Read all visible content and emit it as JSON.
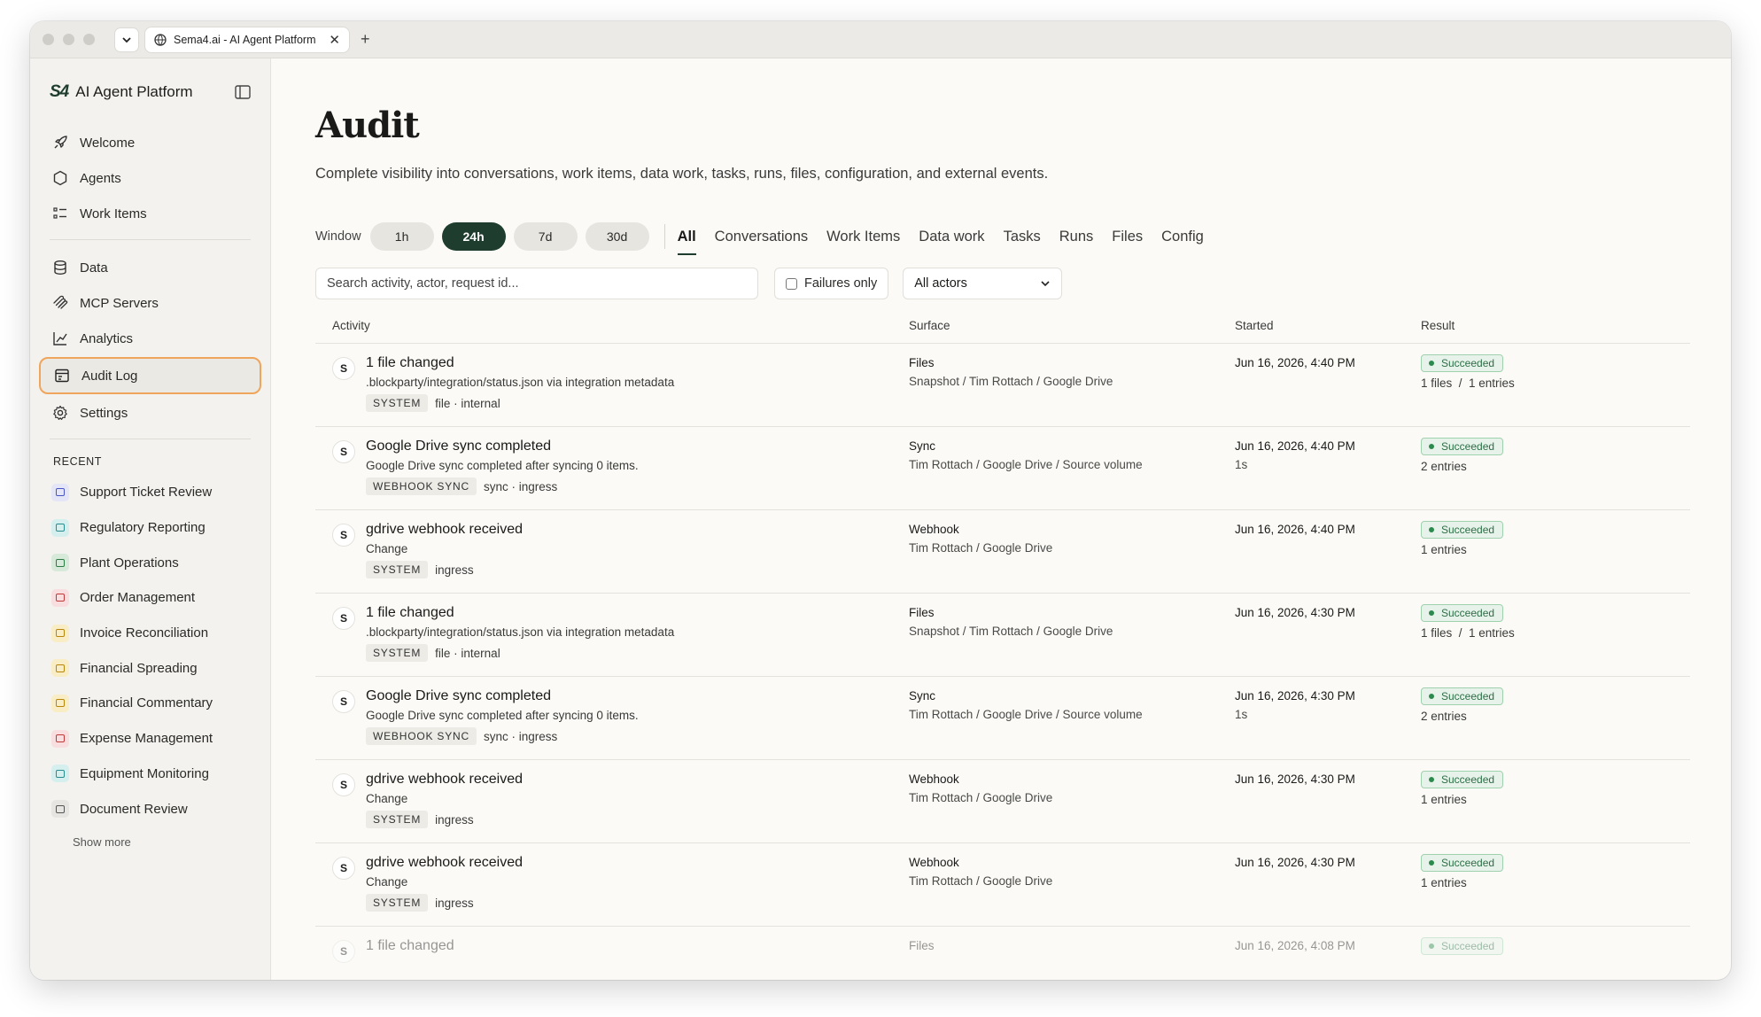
{
  "browser": {
    "tab_title": "Sema4.ai - AI Agent Platform",
    "tab_close": "✕",
    "new_tab": "+"
  },
  "sidebar": {
    "logo": "S4",
    "app_name": "AI Agent Platform",
    "primary": [
      {
        "label": "Welcome",
        "icon": "rocket-icon"
      },
      {
        "label": "Agents",
        "icon": "hexagon-icon"
      },
      {
        "label": "Work Items",
        "icon": "list-icon"
      }
    ],
    "secondary": [
      {
        "label": "Data",
        "icon": "database-icon"
      },
      {
        "label": "MCP Servers",
        "icon": "mcp-icon"
      },
      {
        "label": "Analytics",
        "icon": "chart-icon"
      },
      {
        "label": "Audit Log",
        "icon": "audit-icon",
        "active": true
      },
      {
        "label": "Settings",
        "icon": "gear-icon"
      }
    ],
    "recent_title": "RECENT",
    "recent": [
      {
        "label": "Support Ticket Review",
        "bg": "#e4e6f7",
        "fg": "#4a54c4"
      },
      {
        "label": "Regulatory Reporting",
        "bg": "#d5efef",
        "fg": "#2a8c8c"
      },
      {
        "label": "Plant Operations",
        "bg": "#d7ead9",
        "fg": "#2e7a44"
      },
      {
        "label": "Order Management",
        "bg": "#f8dede",
        "fg": "#c03a3a"
      },
      {
        "label": "Invoice Reconciliation",
        "bg": "#f9edc6",
        "fg": "#b8860b"
      },
      {
        "label": "Financial Spreading",
        "bg": "#f9edc6",
        "fg": "#b8860b"
      },
      {
        "label": "Financial Commentary",
        "bg": "#f9edc6",
        "fg": "#b8860b"
      },
      {
        "label": "Expense Management",
        "bg": "#f8dede",
        "fg": "#c03a3a"
      },
      {
        "label": "Equipment Monitoring",
        "bg": "#d5efef",
        "fg": "#2a8c8c"
      },
      {
        "label": "Document Review",
        "bg": "#e6e5e1",
        "fg": "#555555"
      }
    ],
    "show_more": "Show more"
  },
  "main": {
    "title": "Audit",
    "subtitle": "Complete visibility into conversations, work items, data work, tasks, runs, files, configuration, and external events.",
    "window_label": "Window",
    "windows": [
      {
        "label": "1h",
        "active": false
      },
      {
        "label": "24h",
        "active": true
      },
      {
        "label": "7d",
        "active": false
      },
      {
        "label": "30d",
        "active": false
      }
    ],
    "categories": [
      {
        "label": "All",
        "active": true
      },
      {
        "label": "Conversations"
      },
      {
        "label": "Work Items"
      },
      {
        "label": "Data work"
      },
      {
        "label": "Tasks"
      },
      {
        "label": "Runs"
      },
      {
        "label": "Files"
      },
      {
        "label": "Config"
      }
    ],
    "search_placeholder": "Search activity, actor, request id...",
    "failures_label": "Failures only",
    "actors_value": "All actors",
    "columns": [
      "Activity",
      "Surface",
      "Started",
      "Result"
    ],
    "rows": [
      {
        "avatar": "S",
        "title": "1 file changed",
        "desc": ".blockparty/integration/status.json via integration metadata",
        "tag": "SYSTEM",
        "meta": "file · internal",
        "surface": "Files",
        "path": "Snapshot / Tim Rottach / Google Drive",
        "started": "Jun 16, 2026, 4:40 PM",
        "duration": "",
        "result": "Succeeded",
        "counts": "1 files  /  1 entries"
      },
      {
        "avatar": "S",
        "title": "Google Drive sync completed",
        "desc": "Google Drive sync completed after syncing 0 items.",
        "tag": "WEBHOOK SYNC",
        "meta": "sync · ingress",
        "surface": "Sync",
        "path": "Tim Rottach / Google Drive / Source volume",
        "started": "Jun 16, 2026, 4:40 PM",
        "duration": "1s",
        "result": "Succeeded",
        "counts": "2 entries"
      },
      {
        "avatar": "S",
        "title": "gdrive webhook received",
        "desc": "Change",
        "tag": "SYSTEM",
        "meta": "ingress",
        "surface": "Webhook",
        "path": "Tim Rottach / Google Drive",
        "started": "Jun 16, 2026, 4:40 PM",
        "duration": "",
        "result": "Succeeded",
        "counts": "1 entries"
      },
      {
        "avatar": "S",
        "title": "1 file changed",
        "desc": ".blockparty/integration/status.json via integration metadata",
        "tag": "SYSTEM",
        "meta": "file · internal",
        "surface": "Files",
        "path": "Snapshot / Tim Rottach / Google Drive",
        "started": "Jun 16, 2026, 4:30 PM",
        "duration": "",
        "result": "Succeeded",
        "counts": "1 files  /  1 entries"
      },
      {
        "avatar": "S",
        "title": "Google Drive sync completed",
        "desc": "Google Drive sync completed after syncing 0 items.",
        "tag": "WEBHOOK SYNC",
        "meta": "sync · ingress",
        "surface": "Sync",
        "path": "Tim Rottach / Google Drive / Source volume",
        "started": "Jun 16, 2026, 4:30 PM",
        "duration": "1s",
        "result": "Succeeded",
        "counts": "2 entries"
      },
      {
        "avatar": "S",
        "title": "gdrive webhook received",
        "desc": "Change",
        "tag": "SYSTEM",
        "meta": "ingress",
        "surface": "Webhook",
        "path": "Tim Rottach / Google Drive",
        "started": "Jun 16, 2026, 4:30 PM",
        "duration": "",
        "result": "Succeeded",
        "counts": "1 entries"
      },
      {
        "avatar": "S",
        "title": "gdrive webhook received",
        "desc": "Change",
        "tag": "SYSTEM",
        "meta": "ingress",
        "surface": "Webhook",
        "path": "Tim Rottach / Google Drive",
        "started": "Jun 16, 2026, 4:30 PM",
        "duration": "",
        "result": "Succeeded",
        "counts": "1 entries"
      },
      {
        "avatar": "S",
        "title": "1 file changed",
        "desc": "",
        "tag": "",
        "meta": "",
        "surface": "Files",
        "path": "",
        "started": "Jun 16, 2026, 4:08 PM",
        "duration": "",
        "result": "Succeeded",
        "counts": "",
        "faded": true
      }
    ]
  }
}
